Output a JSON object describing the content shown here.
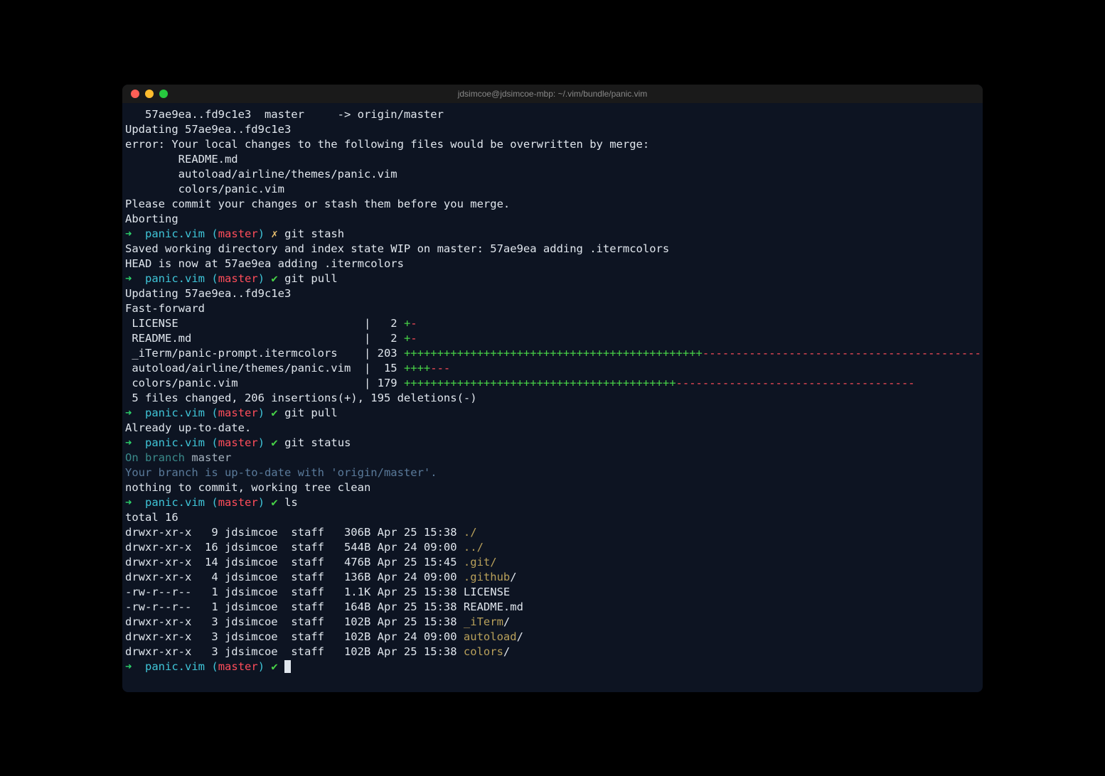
{
  "titlebar": {
    "title": "jdsimcoe@jdsimcoe-mbp: ~/.vim/bundle/panic.vim"
  },
  "prompt": {
    "arrow": "➜",
    "dir": "panic.vim",
    "branch_open": "(",
    "branch_name": "master",
    "branch_close": ")",
    "status_dirty": "✗",
    "status_clean": "✔"
  },
  "fetch": {
    "line": "   57ae9ea..fd9c1e3  master     -> origin/master"
  },
  "pull1": {
    "updating": "Updating 57ae9ea..fd9c1e3",
    "error": "error: Your local changes to the following files would be overwritten by merge:",
    "f1": "        README.md",
    "f2": "        autoload/airline/themes/panic.vim",
    "f3": "        colors/panic.vim",
    "please": "Please commit your changes or stash them before you merge.",
    "aborting": "Aborting"
  },
  "cmds": {
    "stash": "git stash",
    "pull": "git pull",
    "status": "git status",
    "ls": "ls"
  },
  "stash": {
    "saved": "Saved working directory and index state WIP on master: 57ae9ea adding .itermcolors",
    "head": "HEAD is now at 57ae9ea adding .itermcolors"
  },
  "pull2": {
    "updating": "Updating 57ae9ea..fd9c1e3",
    "ff": "Fast-forward",
    "license_file": " LICENSE                            |   2 ",
    "license_plus": "+",
    "license_minus": "-",
    "readme_file": " README.md                          |   2 ",
    "readme_plus": "+",
    "readme_minus": "-",
    "iterm_file": " _iTerm/panic-prompt.itermcolors    | 203 ",
    "iterm_plus": "+++++++++++++++++++++++++++++++++++++++++++++",
    "iterm_minus": "------------------------------------------",
    "airline_file": " autoload/airline/themes/panic.vim  |  15 ",
    "airline_plus": "++++",
    "airline_minus": "---",
    "colors_file": " colors/panic.vim                   | 179 ",
    "colors_plus": "+++++++++++++++++++++++++++++++++++++++++",
    "colors_minus": "------------------------------------",
    "summary": " 5 files changed, 206 insertions(+), 195 deletions(-)"
  },
  "pull3": {
    "uptodate": "Already up-to-date."
  },
  "status": {
    "onbranch": "On branch ",
    "master": "master",
    "uptodate": "Your branch is up-to-date with 'origin/master'.",
    "nothing": "nothing to commit, working tree clean"
  },
  "ls": {
    "total": "total 16",
    "r0_perm": "drwxr-xr-x   9 jdsimcoe  staff   306B Apr 25 15:38 ",
    "r0_name": "./",
    "r1_perm": "drwxr-xr-x  16 jdsimcoe  staff   544B Apr 24 09:00 ",
    "r1_name": "../",
    "r2_perm": "drwxr-xr-x  14 jdsimcoe  staff   476B Apr 25 15:45 ",
    "r2_name": ".git/",
    "r3_perm": "drwxr-xr-x   4 jdsimcoe  staff   136B Apr 24 09:00 ",
    "r3_name": ".github",
    "r3_slash": "/",
    "r4_perm": "-rw-r--r--   1 jdsimcoe  staff   1.1K Apr 25 15:38 LICENSE",
    "r5_perm": "-rw-r--r--   1 jdsimcoe  staff   164B Apr 25 15:38 README.md",
    "r6_perm": "drwxr-xr-x   3 jdsimcoe  staff   102B Apr 25 15:38 ",
    "r6_name": "_iTerm",
    "r6_slash": "/",
    "r7_perm": "drwxr-xr-x   3 jdsimcoe  staff   102B Apr 24 09:00 ",
    "r7_name": "autoload",
    "r7_slash": "/",
    "r8_perm": "drwxr-xr-x   3 jdsimcoe  staff   102B Apr 25 15:38 ",
    "r8_name": "colors",
    "r8_slash": "/"
  }
}
